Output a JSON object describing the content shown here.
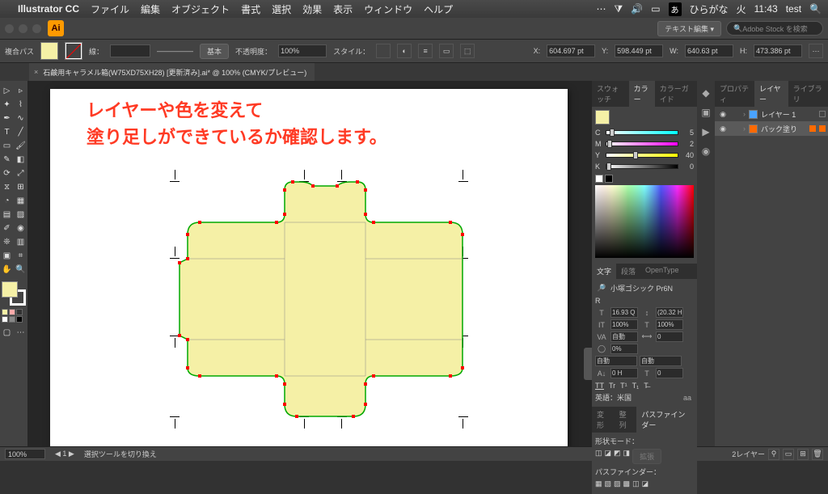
{
  "mac_menu": {
    "app_name": "Illustrator CC",
    "items": [
      "ファイル",
      "編集",
      "オブジェクト",
      "書式",
      "選択",
      "効果",
      "表示",
      "ウィンドウ",
      "ヘルプ"
    ],
    "ime_label": "あ",
    "ime_mode": "ひらがな",
    "weekday": "火",
    "time": "11:43",
    "user": "test"
  },
  "appbar": {
    "search_placeholder": "Adobe Stock を検索",
    "text_edit_label": "テキスト編集 ▾"
  },
  "ctrlbar": {
    "mode_label": "複合パス",
    "stroke_label": "線：",
    "stroke_style_label": "基本",
    "opacity_label": "不透明度：",
    "opacity_value": "100%",
    "style_label": "スタイル：",
    "x_label": "X:",
    "x_value": "604.697 pt",
    "y_label": "Y:",
    "y_value": "598.449 pt",
    "w_label": "W:",
    "w_value": "640.63 pt",
    "h_label": "H:",
    "h_value": "473.386 pt"
  },
  "tab": {
    "filename": "石鹸用キャラメル箱(W75XD75XH28) [更新済み].ai* @ 100% (CMYK/プレビュー)"
  },
  "annotation": {
    "line1": "レイヤーや色を変えて",
    "line2": "塗り足しができているか確認します。"
  },
  "color_panel": {
    "tabs": [
      "スウォッチ",
      "カラー",
      "カラーガイド"
    ],
    "active_tab": 1,
    "c": 5,
    "m": 2,
    "y": 40,
    "k": 0
  },
  "type_panel": {
    "tabs": [
      "文字",
      "段落",
      "OpenType"
    ],
    "font_name": "小塚ゴシック Pr6N",
    "font_style": "R",
    "size": "16.93 Q",
    "leading": "(20.32 H)",
    "vscale": "100%",
    "hscale": "100%",
    "tracking_label": "自動",
    "baseline": "0",
    "opacity": "0%",
    "char_label": "自動",
    "align_label": "自動",
    "rotation": "0 H",
    "t_offset": "0",
    "locale": "英語：米国",
    "aa": "aa"
  },
  "pathfinder_panel": {
    "tabs": [
      "変形",
      "整列",
      "パスファインダー"
    ],
    "shape_mode_label": "形状モード：",
    "expand_label": "拡張",
    "pathfinder_label": "パスファインダー："
  },
  "layers_panel": {
    "tabs": [
      "プロパティ",
      "レイヤー",
      "ライブラリ"
    ],
    "active_tab": 1,
    "layers": [
      {
        "name": "レイヤー 1",
        "color": "#4aa3ff",
        "visible": true,
        "locked": false,
        "selected": false
      },
      {
        "name": "バック塗り",
        "color": "#ff6a00",
        "visible": true,
        "locked": false,
        "selected": true
      }
    ]
  },
  "statusbar": {
    "zoom": "100%",
    "tool_hint": "選択ツールを切り換え",
    "layer_count_label": "2レイヤー"
  }
}
